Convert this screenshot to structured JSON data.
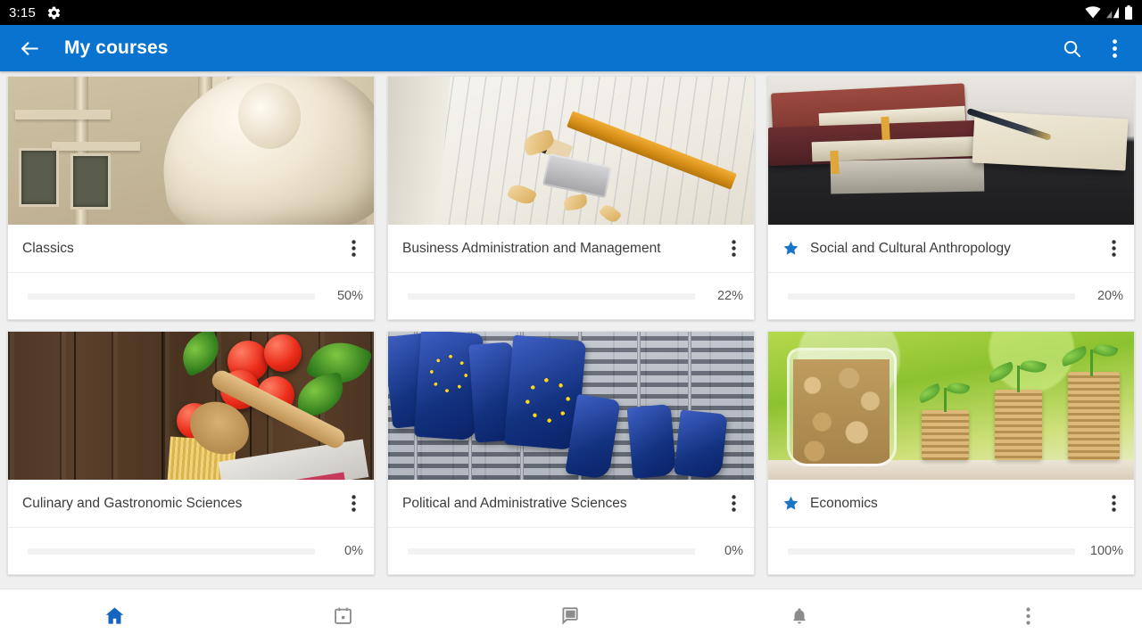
{
  "statusbar": {
    "time": "3:15",
    "icons": [
      "settings-gear-icon",
      "wifi-icon",
      "cell-signal-icon",
      "battery-icon"
    ]
  },
  "appbar": {
    "title": "My courses",
    "back_icon": "back-arrow-icon",
    "search_icon": "search-icon",
    "overflow_icon": "overflow-menu-icon",
    "color": "#0a72cf"
  },
  "theme": {
    "accent": "#0a72cf",
    "progress_fill": "#1b8cdf",
    "progress_track": "#f2f2f2",
    "page_background": "#efefef",
    "card_background": "#ffffff",
    "star_color": "#1b74c4"
  },
  "courses": [
    {
      "title": "Classics",
      "progress": 50,
      "progress_label": "50%",
      "starred": false,
      "thumb": "classical-facade-statue-image",
      "menu_icon": "overflow-menu-icon"
    },
    {
      "title": "Business Administration and Management",
      "progress": 22,
      "progress_label": "22%",
      "starred": false,
      "thumb": "notebook-pencil-sharpener-image",
      "menu_icon": "overflow-menu-icon"
    },
    {
      "title": "Social and Cultural Anthropology",
      "progress": 20,
      "progress_label": "20%",
      "starred": true,
      "thumb": "stacked-books-pen-image",
      "menu_icon": "overflow-menu-icon"
    },
    {
      "title": "Culinary and Gastronomic Sciences",
      "progress": 0,
      "progress_label": "0%",
      "starred": false,
      "thumb": "tomatoes-basil-wooden-spoon-image",
      "menu_icon": "overflow-menu-icon"
    },
    {
      "title": "Political and Administrative Sciences",
      "progress": 0,
      "progress_label": "0%",
      "starred": false,
      "thumb": "eu-flags-building-image",
      "menu_icon": "overflow-menu-icon"
    },
    {
      "title": "Economics",
      "progress": 100,
      "progress_label": "100%",
      "starred": true,
      "thumb": "coin-jar-growing-plants-image",
      "menu_icon": "overflow-menu-icon"
    }
  ],
  "bottomnav": {
    "items": [
      {
        "name": "home-icon",
        "active": true
      },
      {
        "name": "calendar-icon",
        "active": false
      },
      {
        "name": "messages-icon",
        "active": false
      },
      {
        "name": "notifications-bell-icon",
        "active": false
      },
      {
        "name": "more-overflow-icon",
        "active": false
      }
    ]
  }
}
